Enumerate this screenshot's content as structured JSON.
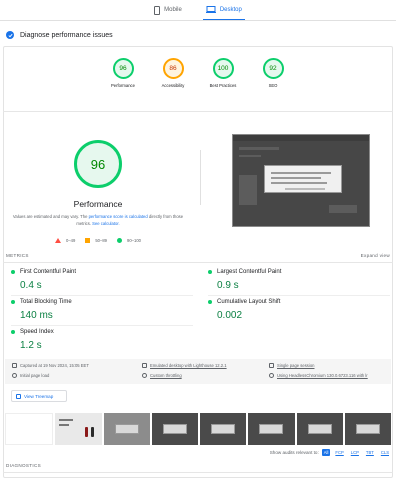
{
  "tabs": [
    {
      "label": "Mobile",
      "icon": "mobile-phone-icon",
      "active": false
    },
    {
      "label": "Desktop",
      "icon": "desktop-icon",
      "active": true
    }
  ],
  "diagnose": {
    "label": "Diagnose performance issues"
  },
  "summary": [
    {
      "score": "96",
      "label": "Performance",
      "status": "good"
    },
    {
      "score": "86",
      "label": "Accessibility",
      "status": "average"
    },
    {
      "score": "100",
      "label": "Best Practices",
      "status": "good"
    },
    {
      "score": "92",
      "label": "SEO",
      "status": "good"
    }
  ],
  "performance": {
    "score": "96",
    "title": "Performance",
    "note_prefix": "Values are estimated and may vary. The ",
    "note_link": "performance score is calculated",
    "note_mid": " directly from those metrics. ",
    "note_calc": "See calculator."
  },
  "legend": {
    "fail": "0–49",
    "average": "50–89",
    "pass": "90–100"
  },
  "metrics": {
    "header": "METRICS",
    "expand": "Expand view",
    "fcp": {
      "label": "First Contentful Paint",
      "value": "0.4 s"
    },
    "lcp": {
      "label": "Largest Contentful Paint",
      "value": "0.9 s"
    },
    "tbt": {
      "label": "Total Blocking Time",
      "value": "140 ms"
    },
    "cls": {
      "label": "Cumulative Layout Shift",
      "value": "0.002"
    },
    "si": {
      "label": "Speed Index",
      "value": "1.2 s"
    }
  },
  "info": {
    "captured": "Captured at 19 Nov 2024, 15:05 EET",
    "load": "Initial page load",
    "emulated": "Emulated desktop with Lighthouse 12.2.1",
    "throttling": "Custom throttling",
    "session": "Single page session",
    "browser": "Using HeadlessChromium 130.0.6723.116 with lr"
  },
  "treemap": {
    "label": "View Treemap"
  },
  "audits": {
    "label": "Show audits relevant to:",
    "chips": [
      "All",
      "FCP",
      "LCP",
      "TBT",
      "CLS"
    ]
  },
  "diagnostics": {
    "header": "DIAGNOSTICS"
  },
  "colors": {
    "good": "#0cce6b",
    "average": "#ffa400",
    "fail": "#ff4e42",
    "accent": "#1a73e8"
  }
}
